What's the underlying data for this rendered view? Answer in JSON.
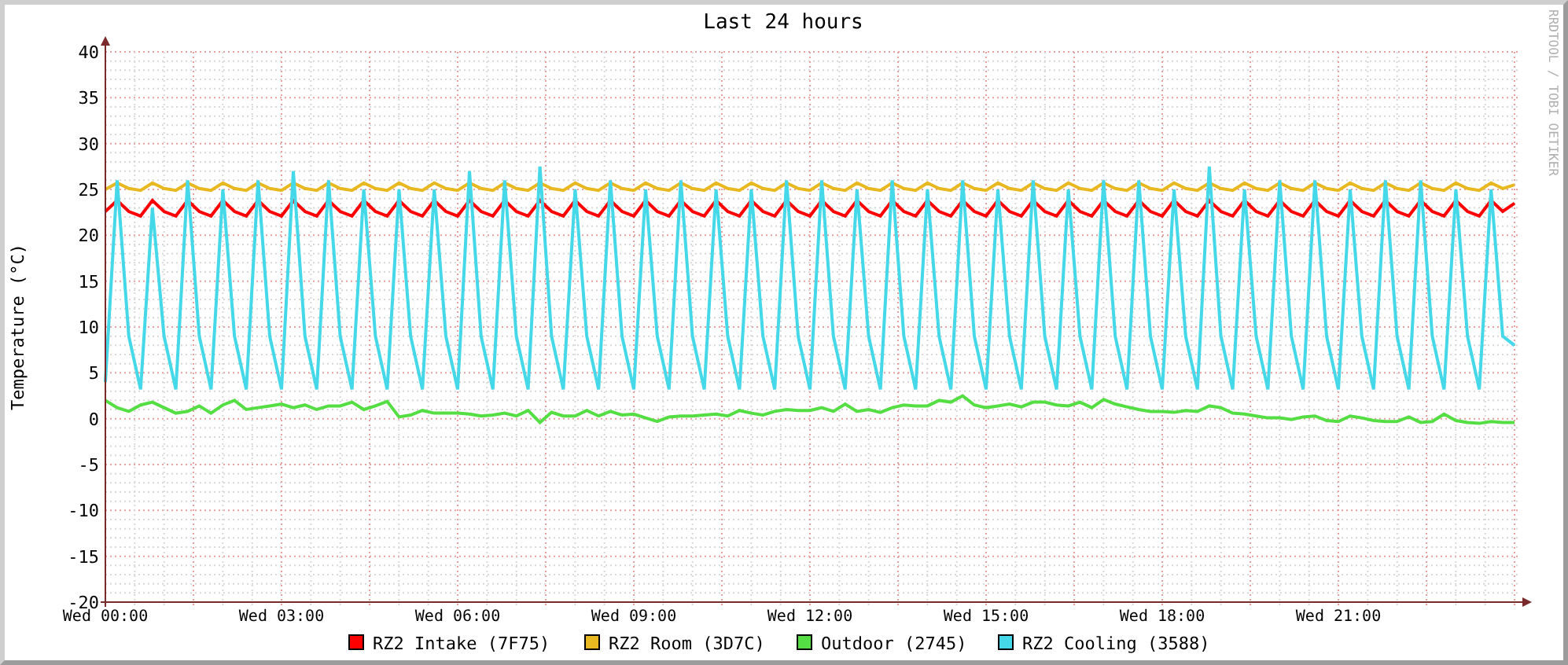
{
  "graph": {
    "side_text": "RRDTOOL / TOBI OETIKER",
    "chart_data": {
      "type": "line",
      "grid": true,
      "legend": "bottom",
      "title": "Last 24 hours",
      "ylabel": "Temperature (°C)",
      "ylim": [
        -20,
        40
      ],
      "yticks": [
        -20,
        -15,
        -10,
        -5,
        0,
        5,
        10,
        15,
        20,
        25,
        30,
        35,
        40
      ],
      "categories": [
        "Wed 00:00",
        null,
        null,
        null,
        null,
        null,
        null,
        null,
        null,
        null,
        null,
        null,
        null,
        null,
        null,
        "Wed 03:00",
        null,
        null,
        null,
        null,
        null,
        null,
        null,
        null,
        null,
        null,
        null,
        null,
        null,
        null,
        "Wed 06:00",
        null,
        null,
        null,
        null,
        null,
        null,
        null,
        null,
        null,
        null,
        null,
        null,
        null,
        null,
        "Wed 09:00",
        null,
        null,
        null,
        null,
        null,
        null,
        null,
        null,
        null,
        null,
        null,
        null,
        null,
        null,
        "Wed 12:00",
        null,
        null,
        null,
        null,
        null,
        null,
        null,
        null,
        null,
        null,
        null,
        null,
        null,
        null,
        "Wed 15:00",
        null,
        null,
        null,
        null,
        null,
        null,
        null,
        null,
        null,
        null,
        null,
        null,
        null,
        null,
        "Wed 18:00",
        null,
        null,
        null,
        null,
        null,
        null,
        null,
        null,
        null,
        null,
        null,
        null,
        null,
        null,
        "Wed 21:00",
        null,
        null,
        null,
        null,
        null,
        null,
        null,
        null,
        null,
        null,
        null,
        null,
        null,
        null,
        null
      ],
      "series": [
        {
          "name": "RZ2 Intake (7F75)",
          "color": "#ff0000",
          "values": [
            22.6,
            23.8,
            22.6,
            22.1,
            23.8,
            22.6,
            22.1,
            23.8,
            22.6,
            22.1,
            23.8,
            22.6,
            22.1,
            23.8,
            22.6,
            22.1,
            23.8,
            22.6,
            22.1,
            23.8,
            22.6,
            22.1,
            23.8,
            22.6,
            22.1,
            23.8,
            22.6,
            22.1,
            23.8,
            22.6,
            22.1,
            23.8,
            22.6,
            22.1,
            23.8,
            22.6,
            22.1,
            23.8,
            22.6,
            22.1,
            23.8,
            22.6,
            22.1,
            23.8,
            22.6,
            22.1,
            23.8,
            22.6,
            22.1,
            23.8,
            22.6,
            22.1,
            23.8,
            22.6,
            22.1,
            23.8,
            22.6,
            22.1,
            23.8,
            22.6,
            22.1,
            23.8,
            22.6,
            22.1,
            23.8,
            22.6,
            22.1,
            23.8,
            22.6,
            22.1,
            23.8,
            22.6,
            22.1,
            23.8,
            22.6,
            22.1,
            23.8,
            22.6,
            22.1,
            23.8,
            22.6,
            22.1,
            23.8,
            22.6,
            22.1,
            23.8,
            22.6,
            22.1,
            23.8,
            22.6,
            22.1,
            23.8,
            22.6,
            22.1,
            23.8,
            22.6,
            22.1,
            23.8,
            22.6,
            22.1,
            23.8,
            22.6,
            22.1,
            23.8,
            22.6,
            22.1,
            23.8,
            22.6,
            22.1,
            23.8,
            22.6,
            22.1,
            23.8,
            22.6,
            22.1,
            23.8,
            22.6,
            22.1,
            23.8,
            22.6,
            23.5
          ]
        },
        {
          "name": "RZ2 Room (3D7C)",
          "color": "#e8b820",
          "values": [
            25,
            25.7,
            25.1,
            24.9,
            25.7,
            25.1,
            24.9,
            25.7,
            25.1,
            24.9,
            25.7,
            25.1,
            24.9,
            25.7,
            25.1,
            24.9,
            25.7,
            25.1,
            24.9,
            25.7,
            25.1,
            24.9,
            25.7,
            25.1,
            24.9,
            25.7,
            25.1,
            24.9,
            25.7,
            25.1,
            24.9,
            25.7,
            25.1,
            24.9,
            25.7,
            25.1,
            24.9,
            25.7,
            25.1,
            24.9,
            25.7,
            25.1,
            24.9,
            25.7,
            25.1,
            24.9,
            25.7,
            25.1,
            24.9,
            25.7,
            25.1,
            24.9,
            25.7,
            25.1,
            24.9,
            25.7,
            25.1,
            24.9,
            25.7,
            25.1,
            24.9,
            25.7,
            25.1,
            24.9,
            25.7,
            25.1,
            24.9,
            25.7,
            25.1,
            24.9,
            25.7,
            25.1,
            24.9,
            25.7,
            25.1,
            24.9,
            25.7,
            25.1,
            24.9,
            25.7,
            25.1,
            24.9,
            25.7,
            25.1,
            24.9,
            25.7,
            25.1,
            24.9,
            25.7,
            25.1,
            24.9,
            25.7,
            25.1,
            24.9,
            25.7,
            25.1,
            24.9,
            25.7,
            25.1,
            24.9,
            25.7,
            25.1,
            24.9,
            25.7,
            25.1,
            24.9,
            25.7,
            25.1,
            24.9,
            25.7,
            25.1,
            24.9,
            25.7,
            25.1,
            24.9,
            25.7,
            25.1,
            24.9,
            25.7,
            25.1,
            25.5
          ]
        },
        {
          "name": "Outdoor (2745)",
          "color": "#55dd44",
          "values": [
            2,
            1.2,
            0.8,
            1.5,
            1.8,
            1.2,
            0.6,
            0.8,
            1.4,
            0.6,
            1.5,
            2,
            1,
            1.2,
            1.4,
            1.6,
            1.2,
            1.5,
            1,
            1.4,
            1.4,
            1.8,
            1,
            1.4,
            1.9,
            0.2,
            0.4,
            0.9,
            0.6,
            0.6,
            0.6,
            0.5,
            0.3,
            0.4,
            0.6,
            0.3,
            0.9,
            -0.4,
            0.7,
            0.3,
            0.3,
            0.9,
            0.3,
            0.8,
            0.4,
            0.5,
            0.1,
            -0.3,
            0.2,
            0.3,
            0.3,
            0.4,
            0.5,
            0.3,
            0.9,
            0.6,
            0.4,
            0.8,
            1,
            0.9,
            0.9,
            1.2,
            0.8,
            1.6,
            0.8,
            1,
            0.7,
            1.2,
            1.5,
            1.4,
            1.4,
            2,
            1.8,
            2.5,
            1.5,
            1.2,
            1.4,
            1.6,
            1.3,
            1.8,
            1.8,
            1.5,
            1.4,
            1.8,
            1.2,
            2.1,
            1.6,
            1.3,
            1,
            0.8,
            0.8,
            0.7,
            0.9,
            0.8,
            1.4,
            1.2,
            0.6,
            0.5,
            0.3,
            0.1,
            0.1,
            -0.1,
            0.2,
            0.3,
            -0.2,
            -0.3,
            0.3,
            0.1,
            -0.2,
            -0.3,
            -0.3,
            0.2,
            -0.4,
            -0.3,
            0.5,
            -0.2,
            -0.4,
            -0.5,
            -0.3,
            -0.4,
            -0.4
          ]
        },
        {
          "name": "RZ2 Cooling (3588)",
          "color": "#44d8e8",
          "values": [
            4,
            26,
            9,
            3.2,
            23,
            9,
            3.2,
            26,
            9,
            3.2,
            25,
            9,
            3.2,
            26,
            9,
            3.2,
            27,
            9,
            3.2,
            26,
            9,
            3.2,
            25,
            9,
            3.2,
            25,
            9,
            3.2,
            25,
            9,
            3.2,
            27,
            9,
            3.2,
            26,
            9,
            3.2,
            27.5,
            9,
            3.2,
            25,
            9,
            3.2,
            26,
            9,
            3.2,
            25,
            9,
            3.2,
            26,
            9,
            3.2,
            25,
            9,
            3.2,
            25,
            9,
            3.2,
            26,
            9,
            3.2,
            26,
            9,
            3.2,
            25,
            9,
            3.2,
            26,
            9,
            3.2,
            25,
            9,
            3.2,
            26,
            9,
            3.2,
            25,
            9,
            3.2,
            26,
            9,
            3.2,
            25,
            9,
            3.2,
            26,
            9,
            3.2,
            26,
            9,
            3.2,
            25,
            9,
            3.2,
            27.5,
            9,
            3.2,
            25,
            9,
            3.2,
            26,
            9,
            3.2,
            26,
            9,
            3.2,
            25,
            9,
            3.2,
            26,
            9,
            3.2,
            26,
            9,
            3.2,
            25,
            9,
            3.2,
            25,
            9,
            8
          ]
        }
      ]
    }
  }
}
